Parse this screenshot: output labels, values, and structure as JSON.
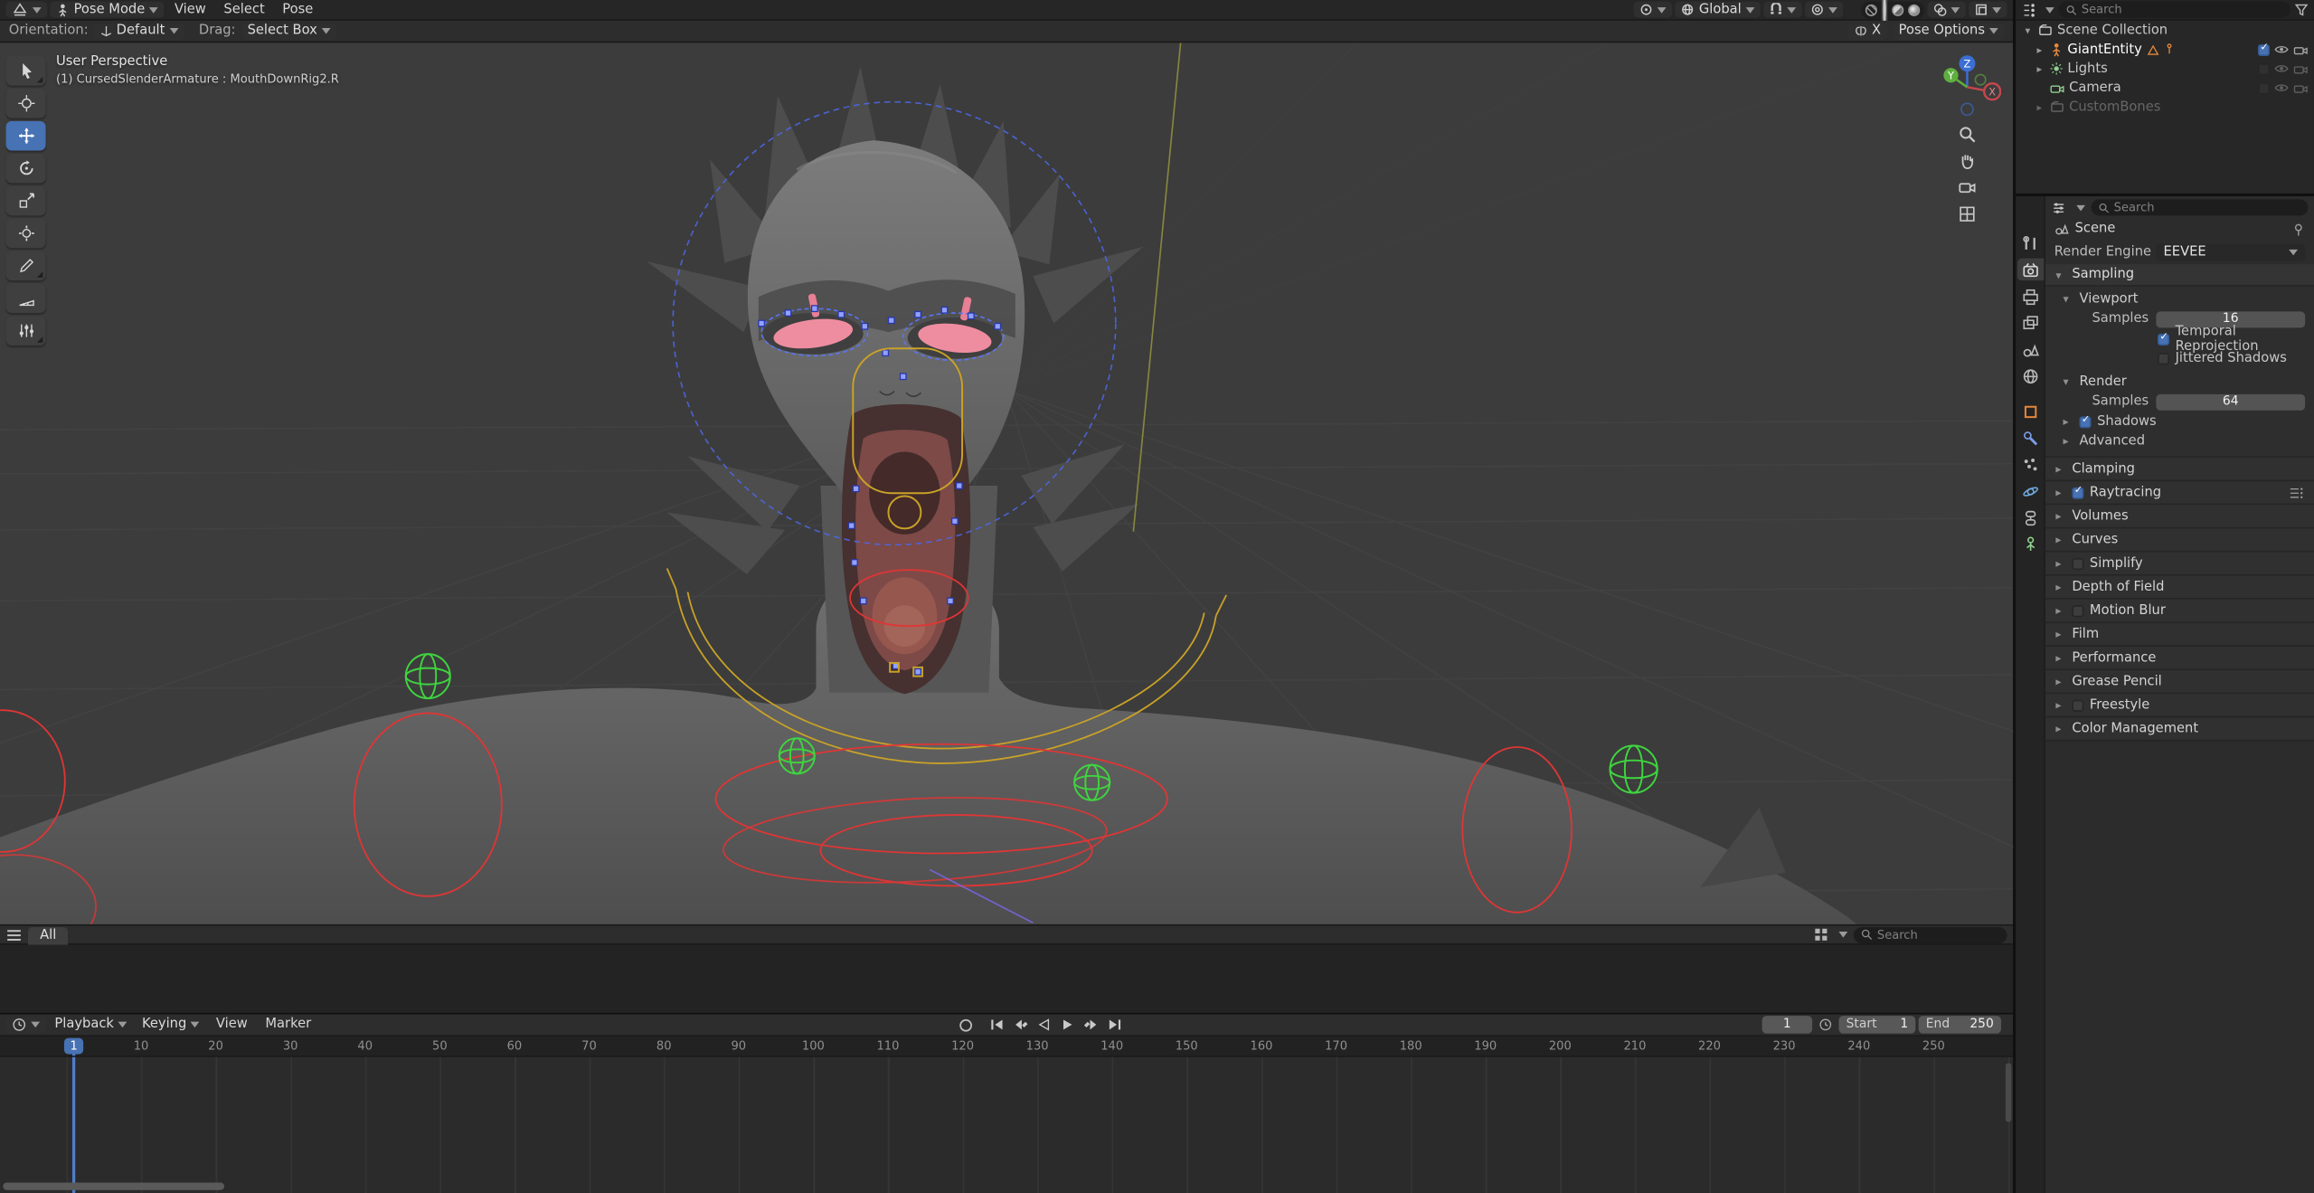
{
  "colors": {
    "accent": "#4772b3",
    "viewport_background": "#3c3c3c",
    "bone_select_blue": "#4d66e0",
    "bone_widget_green": "#3fd43f",
    "bone_widget_red": "#e03535",
    "bone_widget_yellow": "#c9a227"
  },
  "viewport_header": {
    "mode": "Pose Mode",
    "menu_view": "View",
    "menu_select": "Select",
    "menu_pose": "Pose",
    "orientation": "Global"
  },
  "tool_settings": {
    "orientation_label": "Orientation:",
    "orientation_value": "Default",
    "drag_label": "Drag:",
    "drag_value": "Select Box",
    "mirror_x": "X",
    "pose_options": "Pose Options"
  },
  "viewport_overlay": {
    "line1": "User Perspective",
    "line2": "(1) CursedSlenderArmature : MouthDownRig2.R"
  },
  "gizmo": {
    "x": "X",
    "y": "Y",
    "z": "Z"
  },
  "asset_shelf": {
    "tab_all": "All",
    "search_placeholder": "Search"
  },
  "outliner": {
    "search_placeholder": "Search",
    "scene_collection": "Scene Collection",
    "items": [
      {
        "label": "GiantEntity"
      },
      {
        "label": "Lights"
      },
      {
        "label": "Camera"
      },
      {
        "label": "CustomBones"
      }
    ]
  },
  "properties": {
    "search_placeholder": "Search",
    "breadcrumb": "Scene",
    "render_engine_label": "Render Engine",
    "render_engine_value": "EEVEE",
    "sampling": "Sampling",
    "viewport_panel": "Viewport",
    "samples_label": "Samples",
    "viewport_samples": "16",
    "temporal_reprojection": "Temporal Reprojection",
    "jittered_shadows": "Jittered Shadows",
    "render_panel": "Render",
    "render_samples": "64",
    "shadows": "Shadows",
    "advanced": "Advanced",
    "clamping": "Clamping",
    "raytracing": "Raytracing",
    "volumes": "Volumes",
    "curves": "Curves",
    "simplify": "Simplify",
    "depth_of_field": "Depth of Field",
    "motion_blur": "Motion Blur",
    "film": "Film",
    "performance": "Performance",
    "grease_pencil": "Grease Pencil",
    "freestyle": "Freestyle",
    "color_management": "Color Management",
    "states": {
      "temporal_reprojection_checked": true,
      "jittered_shadows_checked": false,
      "shadows_checked": true,
      "raytracing_checked": true,
      "simplify_checked": false,
      "motion_blur_checked": false,
      "freestyle_checked": false
    }
  },
  "timeline": {
    "menu_playback": "Playback",
    "menu_keying": "Keying",
    "menu_view": "View",
    "menu_marker": "Marker",
    "current_frame": "1",
    "start_label": "Start",
    "start_value": "1",
    "end_label": "End",
    "end_value": "250",
    "ticks": [
      "1",
      "10",
      "20",
      "30",
      "40",
      "50",
      "60",
      "70",
      "80",
      "90",
      "100",
      "110",
      "120",
      "130",
      "140",
      "150",
      "160",
      "170",
      "180",
      "190",
      "200",
      "210",
      "220",
      "230",
      "240",
      "250"
    ]
  }
}
